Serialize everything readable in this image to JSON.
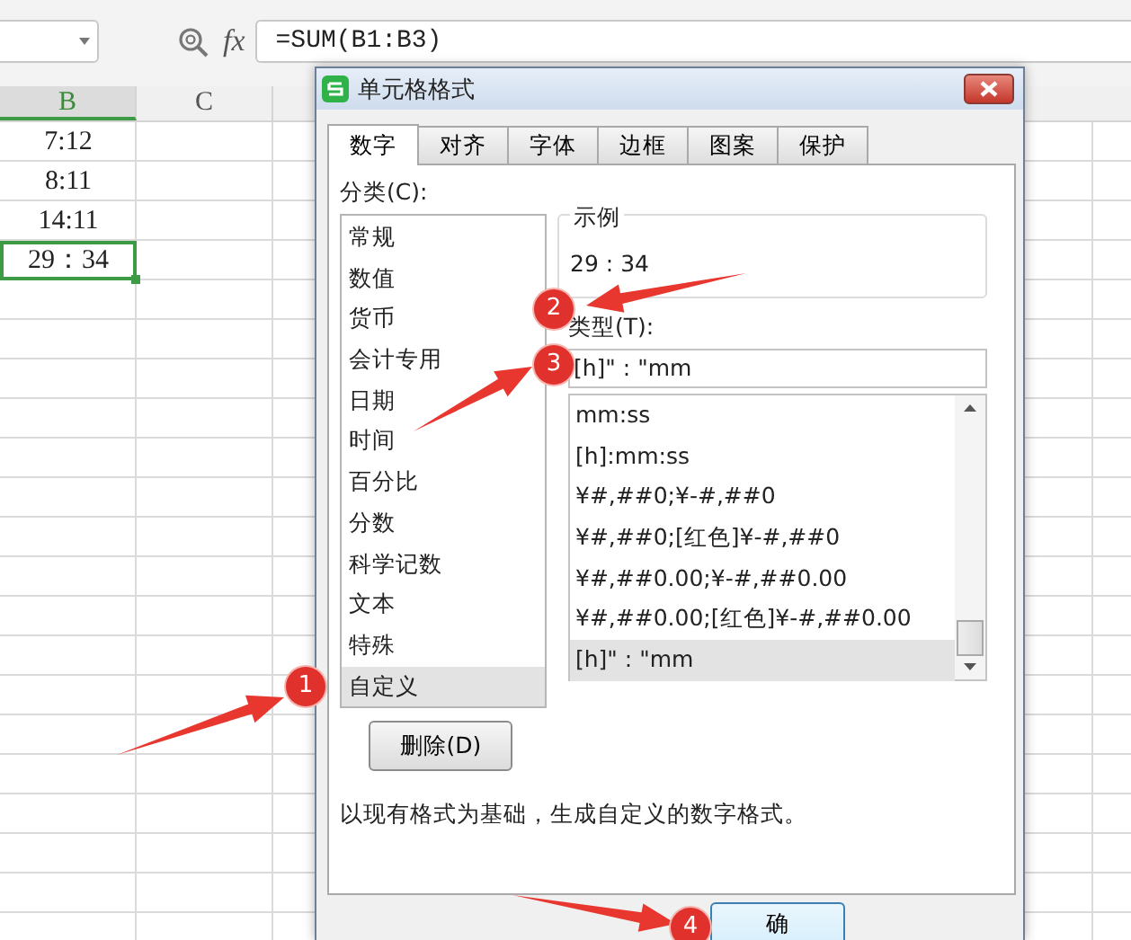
{
  "formula_bar": {
    "formula": "=SUM(B1:B3)",
    "function_label": "fx"
  },
  "sheet": {
    "columns": [
      {
        "label": "B",
        "selected": true
      },
      {
        "label": "C",
        "selected": false
      }
    ],
    "cells": [
      {
        "value": "7:12",
        "selected": false
      },
      {
        "value": "8:11",
        "selected": false
      },
      {
        "value": "14:11",
        "selected": false
      },
      {
        "value": "29：34",
        "selected": true
      }
    ]
  },
  "dialog": {
    "title": "单元格格式",
    "tabs": [
      {
        "label": "数字",
        "selected": true
      },
      {
        "label": "对齐",
        "selected": false
      },
      {
        "label": "字体",
        "selected": false
      },
      {
        "label": "边框",
        "selected": false
      },
      {
        "label": "图案",
        "selected": false
      },
      {
        "label": "保护",
        "selected": false
      }
    ],
    "category_label": "分类(C):",
    "categories": [
      {
        "label": "常规",
        "selected": false
      },
      {
        "label": "数值",
        "selected": false
      },
      {
        "label": "货币",
        "selected": false
      },
      {
        "label": "会计专用",
        "selected": false
      },
      {
        "label": "日期",
        "selected": false
      },
      {
        "label": "时间",
        "selected": false
      },
      {
        "label": "百分比",
        "selected": false
      },
      {
        "label": "分数",
        "selected": false
      },
      {
        "label": "科学记数",
        "selected": false
      },
      {
        "label": "文本",
        "selected": false
      },
      {
        "label": "特殊",
        "selected": false
      },
      {
        "label": "自定义",
        "selected": true
      }
    ],
    "sample": {
      "label": "示例",
      "value": "29 : 34"
    },
    "type_label": "类型(T):",
    "type_input": {
      "value": "[h]\" : \"mm"
    },
    "type_list": [
      {
        "label": "mm:ss",
        "selected": false
      },
      {
        "label": "[h]:mm:ss",
        "selected": false
      },
      {
        "label": "¥#,##0;¥-#,##0",
        "selected": false
      },
      {
        "label": "¥#,##0;[红色]¥-#,##0",
        "selected": false
      },
      {
        "label": "¥#,##0.00;¥-#,##0.00",
        "selected": false
      },
      {
        "label": "¥#,##0.00;[红色]¥-#,##0.00",
        "selected": false
      },
      {
        "label": "[h]\" : \"mm",
        "selected": true
      }
    ],
    "delete_button": "删除(D)",
    "description": "以现有格式为基础，生成自定义的数字格式。",
    "ok_button": "确"
  },
  "annotations": [
    {
      "label": "1"
    },
    {
      "label": "2"
    },
    {
      "label": "3"
    },
    {
      "label": "4"
    }
  ]
}
